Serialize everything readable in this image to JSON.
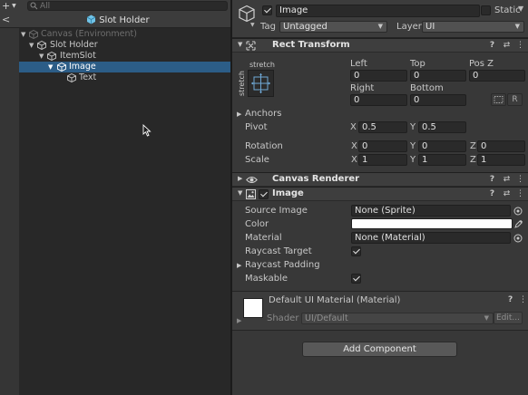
{
  "hierarchy": {
    "add_label": "+",
    "search_placeholder": "All",
    "scene_title": "Slot Holder",
    "back_label": "<",
    "items": [
      {
        "label": "Canvas (Environment)"
      },
      {
        "label": "Slot Holder"
      },
      {
        "label": "ItemSlot"
      },
      {
        "label": "Image"
      },
      {
        "label": "Text"
      }
    ]
  },
  "inspector": {
    "object_name": "Image",
    "active": true,
    "static_label": "Static",
    "tag_label": "Tag",
    "tag_value": "Untagged",
    "layer_label": "Layer",
    "layer_value": "UI",
    "rect_transform": {
      "title": "Rect Transform",
      "anchor_preset_top": "stretch",
      "anchor_preset_side": "stretch",
      "left_label": "Left",
      "left_value": "0",
      "top_label": "Top",
      "top_value": "0",
      "posz_label": "Pos Z",
      "posz_value": "0",
      "right_label": "Right",
      "right_value": "0",
      "bottom_label": "Bottom",
      "bottom_value": "0",
      "raw_edit_label": "R",
      "anchors_label": "Anchors",
      "pivot_label": "Pivot",
      "pivot_x": "0.5",
      "pivot_y": "0.5",
      "rotation_label": "Rotation",
      "rotation_x": "0",
      "rotation_y": "0",
      "rotation_z": "0",
      "scale_label": "Scale",
      "scale_x": "1",
      "scale_y": "1",
      "scale_z": "1",
      "axis_x": "X",
      "axis_y": "Y",
      "axis_z": "Z"
    },
    "canvas_renderer": {
      "title": "Canvas Renderer"
    },
    "image": {
      "title": "Image",
      "enabled": true,
      "source_image_label": "Source Image",
      "source_image_value": "None (Sprite)",
      "color_label": "Color",
      "color_value": "#ffffff",
      "material_label": "Material",
      "material_value": "None (Material)",
      "raycast_target_label": "Raycast Target",
      "raycast_target": true,
      "raycast_padding_label": "Raycast Padding",
      "maskable_label": "Maskable",
      "maskable": true
    },
    "material": {
      "name": "Default UI Material (Material)",
      "shader_label": "Shader",
      "shader_value": "UI/Default",
      "edit_label": "Edit..."
    },
    "add_component_label": "Add Component",
    "help_glyph": "?",
    "preset_glyph": "⇄",
    "more_glyph": "⋮"
  },
  "colors": {
    "selection": "#2c5d87",
    "panel_bg": "#383838",
    "hierarchy_bg": "#282828",
    "prefab_icon": "#6fc3e8"
  }
}
